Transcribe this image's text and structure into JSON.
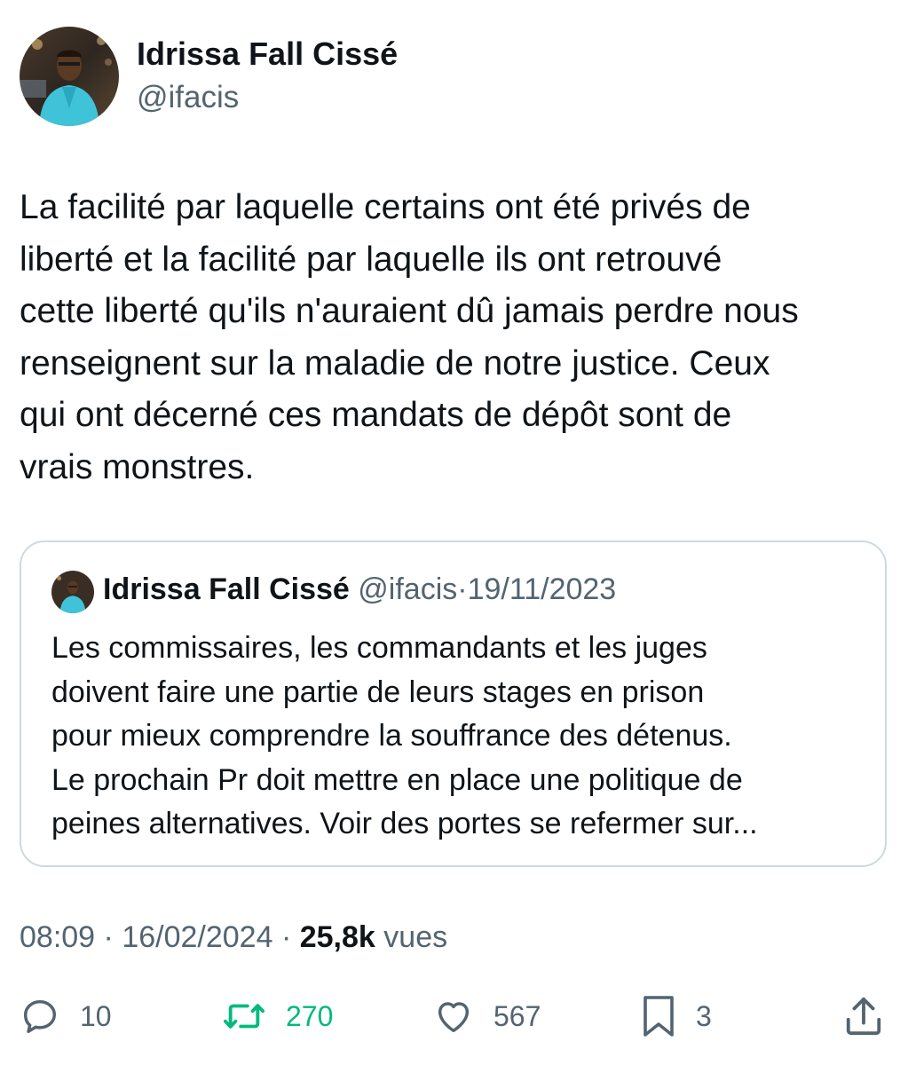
{
  "tweet": {
    "author": {
      "name": "Idrissa Fall Cissé",
      "handle": "@ifacis",
      "avatar_icon": "profile-photo-avatar"
    },
    "text": "La facilité par laquelle certains ont été privés de\nliberté et la facilité par laquelle ils ont retrouvé\ncette liberté qu'ils n'auraient dû jamais perdre nous\nrenseignent sur la maladie de notre justice. Ceux\nqui ont décerné ces mandats de dépôt sont de\nvrais monstres.",
    "quoted": {
      "author_name": "Idrissa Fall Cissé",
      "handle": "@ifacis",
      "separator": "·",
      "date": "19/11/2023",
      "text": "Les commissaires, les commandants et les juges\ndoivent faire une partie de leurs stages en prison\npour mieux comprendre la souffrance des détenus.\nLe prochain Pr doit mettre en place une politique de\npeines alternatives. Voir des portes se refermer sur..."
    },
    "meta": {
      "time": "08:09",
      "separator": "·",
      "date": "16/02/2024",
      "views_count": "25,8k",
      "views_label": "vues"
    },
    "actions": {
      "replies": {
        "icon": "reply-icon",
        "count": "10"
      },
      "retweets": {
        "icon": "retweet-icon",
        "count": "270",
        "color": "#00ba7c"
      },
      "likes": {
        "icon": "heart-icon",
        "count": "567"
      },
      "bookmarks": {
        "icon": "bookmark-icon",
        "count": "3"
      },
      "share": {
        "icon": "share-icon"
      }
    }
  },
  "colors": {
    "text": "#0f1419",
    "secondary": "#536471",
    "border": "#cfd9de",
    "retweet_green": "#00ba7c"
  }
}
